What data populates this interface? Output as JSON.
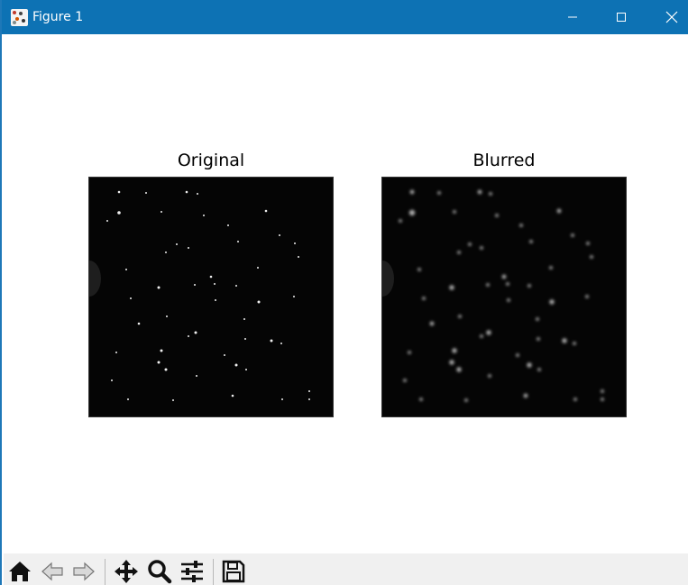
{
  "window": {
    "title": "Figure 1",
    "icon": "matplotlib-figure-icon"
  },
  "window_controls": {
    "minimize_icon": "minimize-icon",
    "maximize_icon": "maximize-icon",
    "close_icon": "close-icon"
  },
  "figure": {
    "left_axes_title": "Original",
    "right_axes_title": "Blurred",
    "image_colormap": "gray"
  },
  "toolbar": {
    "icons": [
      "home-icon",
      "back-arrow-icon",
      "forward-arrow-icon",
      "pan-icon",
      "zoom-icon",
      "configure-subplots-icon",
      "save-icon"
    ]
  },
  "colors": {
    "titlebar": "#0d72b4",
    "toolbar_bg": "#f0f0f0",
    "plot_bg": "#050505"
  }
}
